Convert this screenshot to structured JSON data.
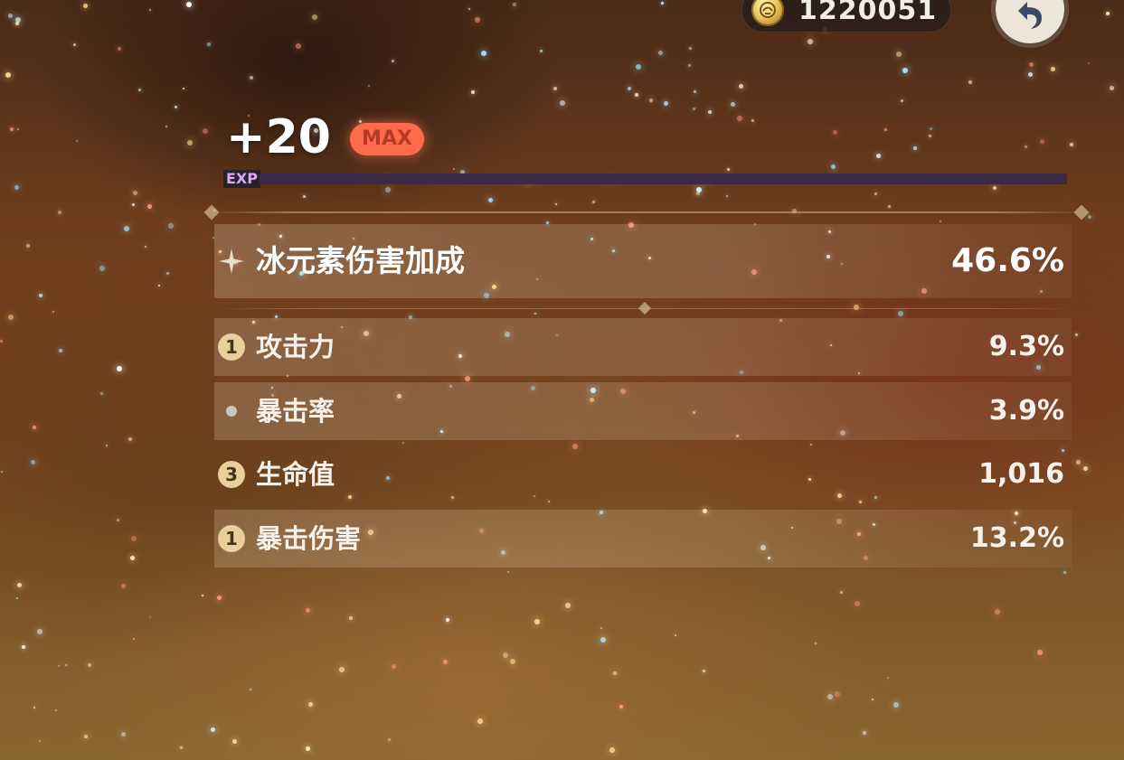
{
  "currency": {
    "icon": "mora-coin-icon",
    "value": "1220051"
  },
  "back_button": {
    "icon": "back-arrow-icon"
  },
  "level": {
    "value": "+20",
    "max_label": "MAX"
  },
  "exp": {
    "label": "EXP",
    "fill_fraction": 0
  },
  "main_stat": {
    "icon": "sparkle-icon",
    "name": "冰元素伤害加成",
    "value": "46.6%"
  },
  "sub_stats": [
    {
      "badge": "1",
      "name": "攻击力",
      "value": "9.3%"
    },
    {
      "badge": "",
      "name": "暴击率",
      "value": "3.9%"
    },
    {
      "badge": "3",
      "name": "生命值",
      "value": "1,016"
    },
    {
      "badge": "1",
      "name": "暴击伤害",
      "value": "13.2%"
    }
  ],
  "colors": {
    "max_badge": "#ff6a4a",
    "exp_bar": "#3a2a48",
    "exp_label": "#d9a8f0",
    "upgrade_badge": "#e9cf9a",
    "text": "#ffffff"
  }
}
